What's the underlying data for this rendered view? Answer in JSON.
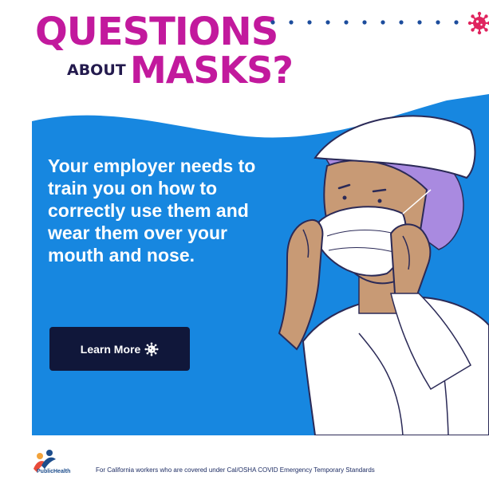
{
  "headline": {
    "line1": "QUESTIONS",
    "about": "ABOUT",
    "masks": "MASKS?"
  },
  "message": "Your employer needs to train you on how to correctly use them and wear them over your mouth and nose.",
  "cta": {
    "label": "Learn More",
    "icon": "virus-icon"
  },
  "footer": {
    "logo_text": "PublicHealth",
    "disclaimer": "For California workers who are covered under Cal/OSHA COVID Emergency Temporary Standards"
  },
  "colors": {
    "headline": "#c2199d",
    "banner": "#1787e0",
    "button": "#10173a",
    "text_dark": "#231a4d"
  }
}
